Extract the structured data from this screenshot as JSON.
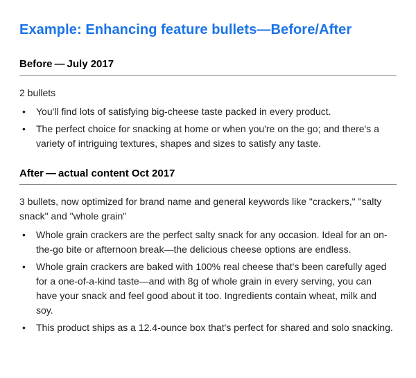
{
  "title": "Example: Enhancing feature bullets—Before/After",
  "before": {
    "heading": "Before — July 2017",
    "intro": "2 bullets",
    "bullets": [
      "You'll find lots of satisfying big-cheese taste packed in every product.",
      "The perfect choice for snacking at home or when you're on the go; and there's a variety of intriguing textures, shapes and sizes to satisfy any taste."
    ]
  },
  "after": {
    "heading": "After — actual content Oct 2017",
    "intro": "3 bullets, now optimized for brand name and general keywords like \"crackers,\" \"salty snack\" and \"whole grain\"",
    "bullets": [
      "Whole grain crackers are the perfect salty snack for any occasion. Ideal for an on-the-go bite or afternoon break—the delicious cheese options are endless.",
      "Whole grain crackers are baked with 100% real cheese that's been carefully aged for a one-of-a-kind taste—and with 8g of whole grain in every serving, you can have your snack and feel good about it too. Ingredients contain wheat, milk and soy.",
      "This product ships as a 12.4-ounce box that's perfect for shared and solo snacking."
    ]
  }
}
